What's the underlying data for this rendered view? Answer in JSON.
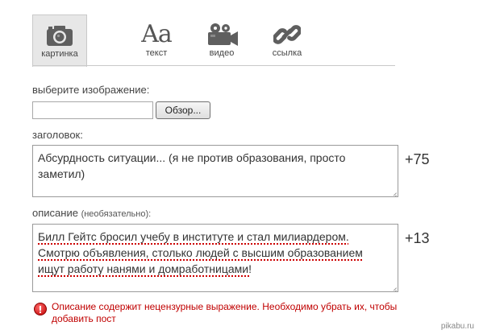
{
  "tabs": [
    {
      "label": "картинка",
      "icon": "camera-icon",
      "active": true
    },
    {
      "label": "текст",
      "icon": "text-aa-icon",
      "glyph": "Aa",
      "active": false
    },
    {
      "label": "видео",
      "icon": "video-camera-icon",
      "active": false
    },
    {
      "label": "ссылка",
      "icon": "link-chain-icon",
      "active": false
    }
  ],
  "image_field": {
    "label": "выберите изображение:",
    "value": "",
    "browse_label": "Обзор..."
  },
  "title_field": {
    "label": "заголовок:",
    "value": "Абсурдность ситуации... (я не против образования, просто заметил)",
    "counter": "+75"
  },
  "description_field": {
    "label": "описание",
    "optional_note": "(необязательно):",
    "lines": [
      "Билл Гейтс бросил учебу в институте и стал милиардером.",
      "Смотрю объявления, столько людей с высшим образованием",
      "ищут работу нанями и домработницами!"
    ],
    "counter": "+13"
  },
  "error": {
    "icon": "error-icon",
    "color": "#c00000",
    "text": "Описание содержит нецензурные выражение. Необходимо убрать их, чтобы добавить пост"
  },
  "watermark": "pikabu.ru"
}
